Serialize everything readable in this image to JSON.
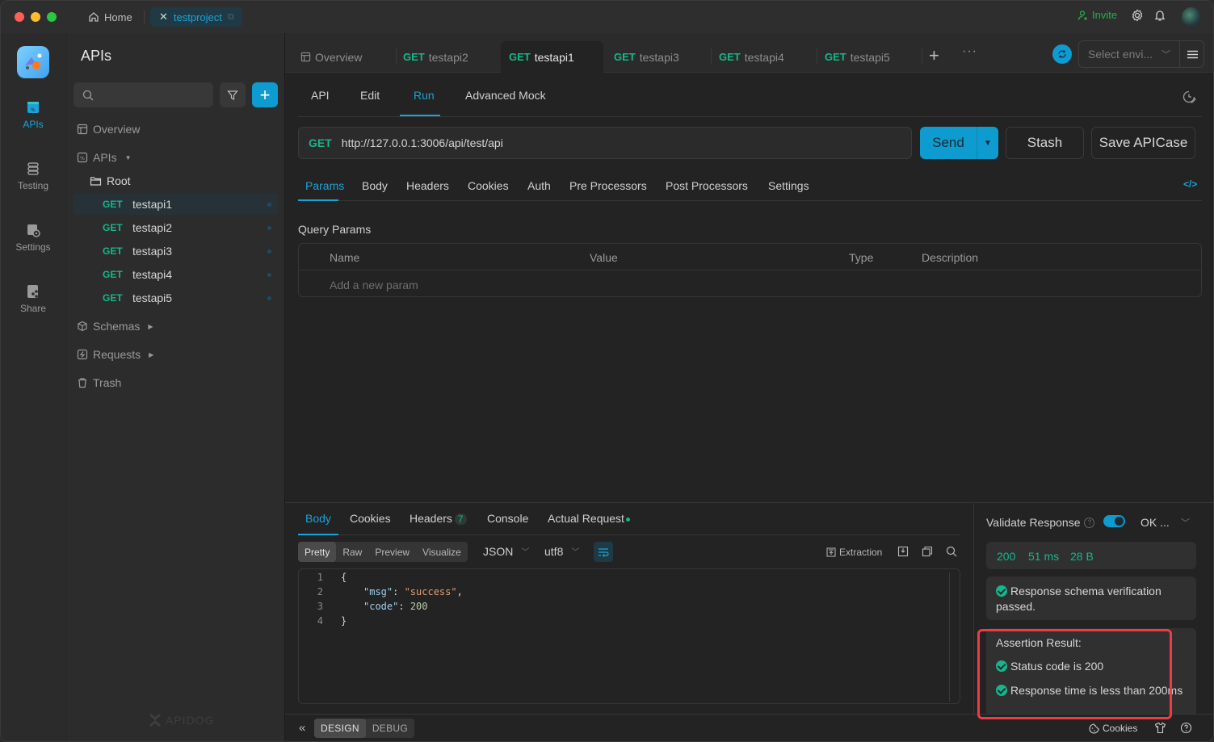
{
  "titlebar": {
    "home_label": "Home",
    "project_tab": "testproject",
    "invite_label": "Invite",
    "icons": [
      "home-icon",
      "close-icon",
      "external-link-icon",
      "invite-icon",
      "settings-icon",
      "bell-icon",
      "avatar"
    ]
  },
  "rail": {
    "items": [
      {
        "label": "APIs",
        "icon": "apis-icon",
        "active": true
      },
      {
        "label": "Testing",
        "icon": "testing-icon"
      },
      {
        "label": "Settings",
        "icon": "settings-icon"
      },
      {
        "label": "Share",
        "icon": "share-icon"
      }
    ]
  },
  "sidebar": {
    "title": "APIs",
    "search_placeholder": "",
    "overview": "Overview",
    "apis_group": "APIs",
    "root_folder": "Root",
    "endpoints": [
      {
        "method": "GET",
        "name": "testapi1",
        "active": true
      },
      {
        "method": "GET",
        "name": "testapi2"
      },
      {
        "method": "GET",
        "name": "testapi3"
      },
      {
        "method": "GET",
        "name": "testapi4"
      },
      {
        "method": "GET",
        "name": "testapi5"
      }
    ],
    "schemas": "Schemas",
    "requests": "Requests",
    "trash": "Trash",
    "brand": "APIDOG"
  },
  "file_tabs": [
    {
      "label": "Overview",
      "method": ""
    },
    {
      "label": "testapi2",
      "method": "GET"
    },
    {
      "label": "testapi1",
      "method": "GET",
      "active": true
    },
    {
      "label": "testapi3",
      "method": "GET"
    },
    {
      "label": "testapi4",
      "method": "GET"
    },
    {
      "label": "testapi5",
      "method": "GET"
    }
  ],
  "environment": {
    "placeholder": "Select envi..."
  },
  "sub_tabs": [
    {
      "label": "API"
    },
    {
      "label": "Edit"
    },
    {
      "label": "Run",
      "active": true
    },
    {
      "label": "Advanced Mock"
    }
  ],
  "request": {
    "method": "GET",
    "url": "http://127.0.0.1:3006/api/test/api",
    "send_label": "Send",
    "stash_label": "Stash",
    "save_label": "Save APICase"
  },
  "request_tabs": [
    {
      "label": "Params",
      "active": true
    },
    {
      "label": "Body"
    },
    {
      "label": "Headers"
    },
    {
      "label": "Cookies"
    },
    {
      "label": "Auth"
    },
    {
      "label": "Pre Processors"
    },
    {
      "label": "Post Processors"
    },
    {
      "label": "Settings"
    }
  ],
  "query_params": {
    "title": "Query Params",
    "columns": [
      "Name",
      "Value",
      "Type",
      "Description"
    ],
    "placeholder": "Add a new param"
  },
  "response": {
    "tabs": [
      {
        "label": "Body",
        "active": true
      },
      {
        "label": "Cookies"
      },
      {
        "label": "Headers",
        "badge": "7"
      },
      {
        "label": "Console"
      },
      {
        "label": "Actual Request",
        "dot": true
      }
    ],
    "formats": [
      "Pretty",
      "Raw",
      "Preview",
      "Visualize"
    ],
    "active_format": "Pretty",
    "language": "JSON",
    "encoding": "utf8",
    "extraction_label": "Extraction",
    "lines": [
      {
        "n": "1",
        "text": "{"
      },
      {
        "n": "2",
        "key": "\"msg\"",
        "sep": ": ",
        "str": "\"success\"",
        "end": ","
      },
      {
        "n": "3",
        "key": "\"code\"",
        "sep": ": ",
        "num": "200"
      },
      {
        "n": "4",
        "text": "}"
      }
    ]
  },
  "validate": {
    "label": "Validate Response",
    "enabled": true,
    "selected": "OK ...",
    "status": "200",
    "time": "51 ms",
    "size": "28 B",
    "schema_msg": "Response schema verification passed.",
    "assertion_title": "Assertion Result:",
    "assertions": [
      "Status code is 200",
      "Response time is less than 200ms"
    ]
  },
  "footer": {
    "modes": [
      "DESIGN",
      "DEBUG"
    ],
    "active_mode": "DESIGN",
    "cookies_label": "Cookies"
  },
  "colors": {
    "accent": "#0d9bd0",
    "method_get": "#16b68a",
    "highlight": "#ee3b46"
  }
}
